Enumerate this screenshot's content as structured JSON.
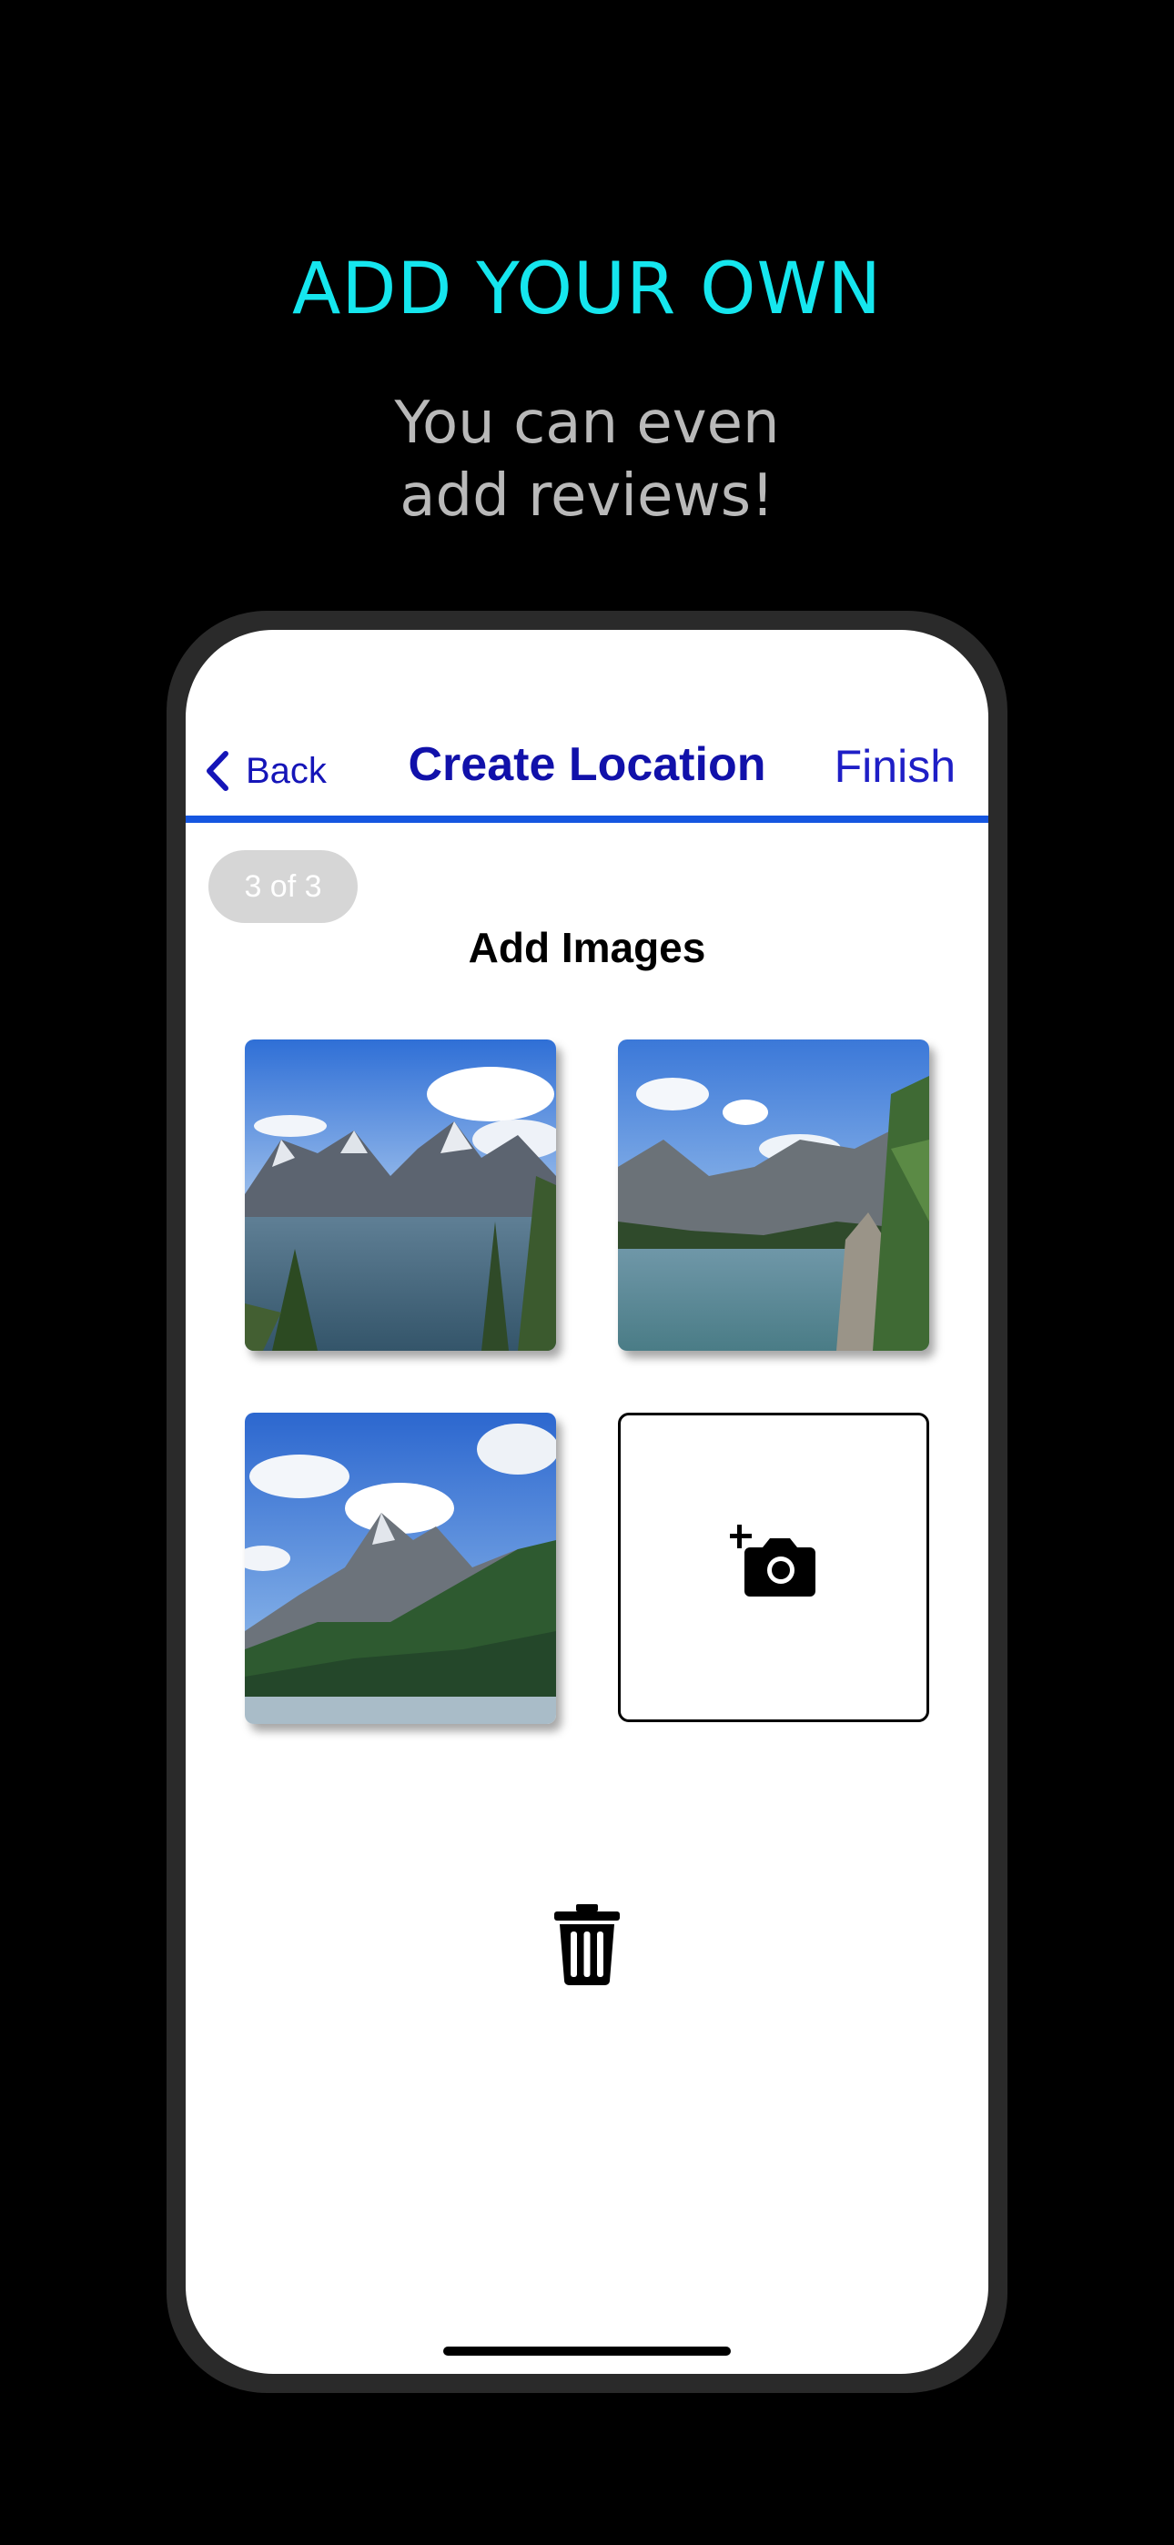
{
  "promo": {
    "title": "ADD YOUR OWN",
    "subtitle_line1": "You can even",
    "subtitle_line2": "add reviews!"
  },
  "nav": {
    "back_label": "Back",
    "title": "Create Location",
    "finish_label": "Finish"
  },
  "step_badge": "3 of 3",
  "section_title": "Add Images",
  "icons": {
    "back": "chevron-left-icon",
    "add_photo": "add-camera-icon",
    "delete": "trash-icon"
  },
  "colors": {
    "background": "#000000",
    "promo_title": "#15e6ee",
    "promo_subtitle": "#b9b9b9",
    "nav_accent": "#1556e0",
    "nav_text": "#1111aa"
  }
}
